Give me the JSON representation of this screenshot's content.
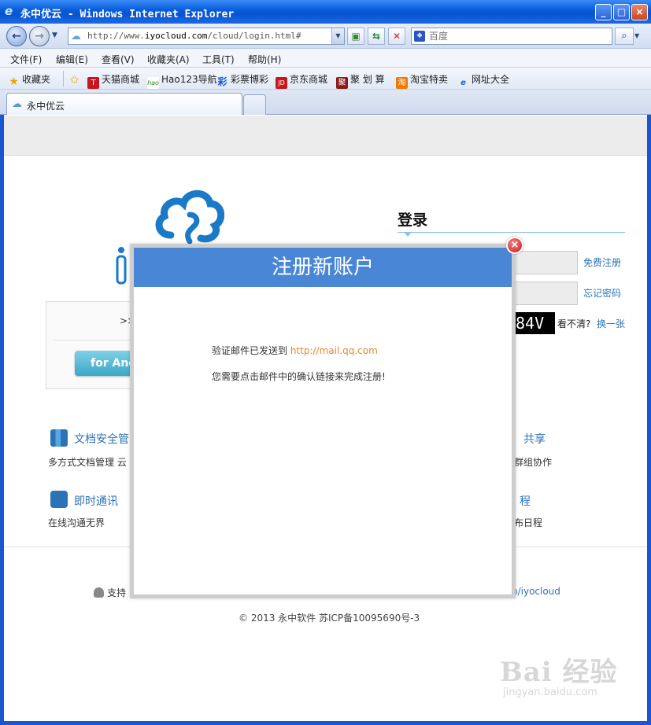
{
  "window": {
    "title": "永中优云 - Windows Internet Explorer",
    "min_label": "_",
    "max_label": "□",
    "close_label": "×"
  },
  "address_bar": {
    "url_prefix": "http://www.",
    "url_host": "iyocloud.com",
    "url_path": "/cloud/login.html#"
  },
  "search": {
    "placeholder": "百度",
    "engine_icon": "baidu-paw-icon"
  },
  "menu": [
    "文件(F)",
    "编辑(E)",
    "查看(V)",
    "收藏夹(A)",
    "工具(T)",
    "帮助(H)"
  ],
  "favorites": {
    "label": "收藏夹",
    "items": [
      "天猫商城",
      "Hao123导航",
      "彩票博彩",
      "京东商城",
      "聚 划 算",
      "淘宝特卖",
      "网址大全"
    ],
    "icons": [
      "T",
      "hao",
      "彩",
      "JD",
      "聚",
      "淘",
      "e"
    ]
  },
  "tab": {
    "title": "永中优云"
  },
  "login": {
    "title": "登录",
    "register_link": "免费注册",
    "forgot_link": "忘记密码",
    "captcha_text": "84V",
    "captcha_hint": "看不清?",
    "captcha_change": "换一张"
  },
  "left_card": {
    "arrows": ">>",
    "android_button": "for And"
  },
  "features": [
    {
      "title": "文档安全管",
      "desc": "多方式文档管理 云"
    },
    {
      "title": "共享",
      "desc": "群组协作"
    },
    {
      "title": "即时通讯",
      "desc": "在线沟通无界"
    },
    {
      "title": "程",
      "desc": "布日程"
    }
  ],
  "footer": {
    "support": "支持",
    "weibo": "n/iyocloud",
    "copyright": "© 2013 永中软件  苏ICP备10095690号-3"
  },
  "modal": {
    "title": "注册新账户",
    "sent_prefix": "验证邮件已发送到 ",
    "sent_link": "http://mail.qq.com",
    "instruction": "您需要点击邮件中的确认链接来完成注册!",
    "close_label": "×"
  },
  "watermark": {
    "brand": "Bai 经验",
    "url": "jingyan.baidu.com"
  },
  "colors": {
    "modal_header": "#4a86d6",
    "link": "#2b73b6",
    "mail_link": "#e58a2a",
    "ie_frame": "#1a56cf"
  }
}
